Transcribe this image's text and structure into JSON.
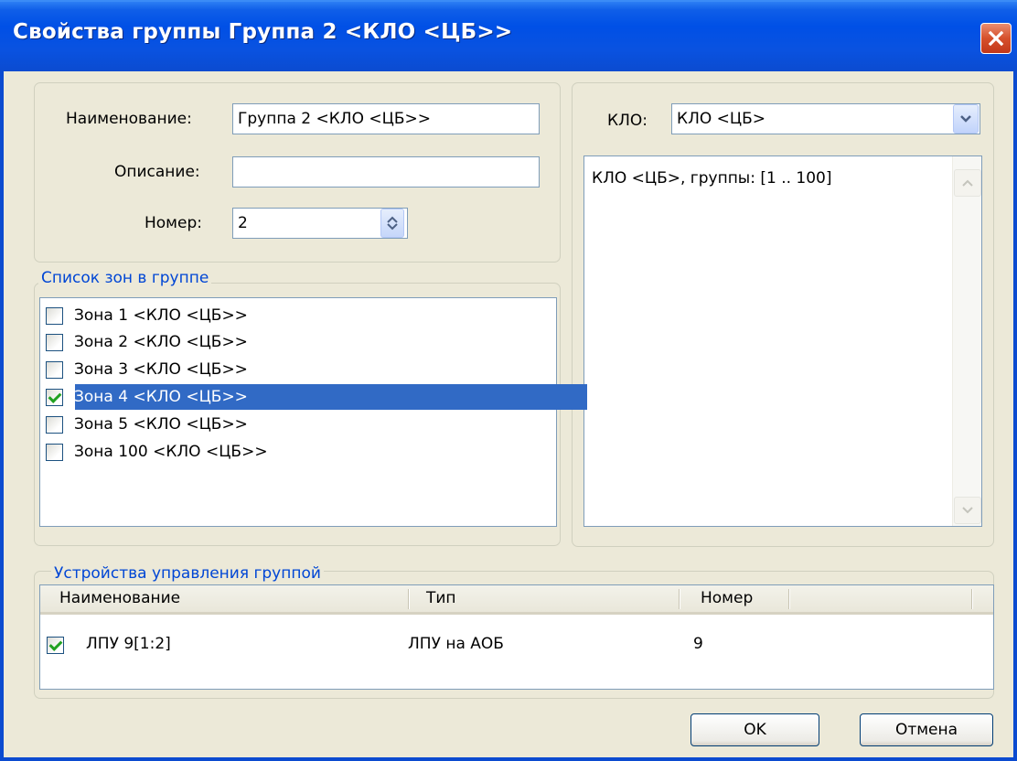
{
  "window": {
    "title": "Свойства группы Группа 2 <КЛО <ЦБ>>"
  },
  "props": {
    "name_label": "Наименование:",
    "name_value": "Группа 2 <КЛО <ЦБ>>",
    "desc_label": "Описание:",
    "desc_value": "",
    "number_label": "Номер:",
    "number_value": "2"
  },
  "klo": {
    "label": "КЛО:",
    "selected": "КЛО <ЦБ>",
    "info": "КЛО <ЦБ>, группы:  [1 .. 100]"
  },
  "zones": {
    "legend": "Список зон в группе",
    "items": [
      {
        "label": "Зона 1 <КЛО <ЦБ>>",
        "checked": false,
        "selected": false
      },
      {
        "label": "Зона 2 <КЛО <ЦБ>>",
        "checked": false,
        "selected": false
      },
      {
        "label": "Зона 3 <КЛО <ЦБ>>",
        "checked": false,
        "selected": false
      },
      {
        "label": "Зона 4 <КЛО <ЦБ>>",
        "checked": true,
        "selected": true
      },
      {
        "label": "Зона 5 <КЛО <ЦБ>>",
        "checked": false,
        "selected": false
      },
      {
        "label": "Зона 100 <КЛО <ЦБ>>",
        "checked": false,
        "selected": false
      }
    ]
  },
  "devices": {
    "legend": "Устройства управления группой",
    "columns": [
      "Наименование",
      "Тип",
      "Номер"
    ],
    "rows": [
      {
        "checked": true,
        "name": "ЛПУ 9[1:2]",
        "type": "ЛПУ на АОБ",
        "number": "9"
      }
    ]
  },
  "buttons": {
    "ok": "OK",
    "cancel": "Отмена"
  },
  "colors": {
    "titlebar": "#0050e6",
    "selection": "#316ac5",
    "group_legend": "#0046d5",
    "close_button": "#d6502c"
  }
}
